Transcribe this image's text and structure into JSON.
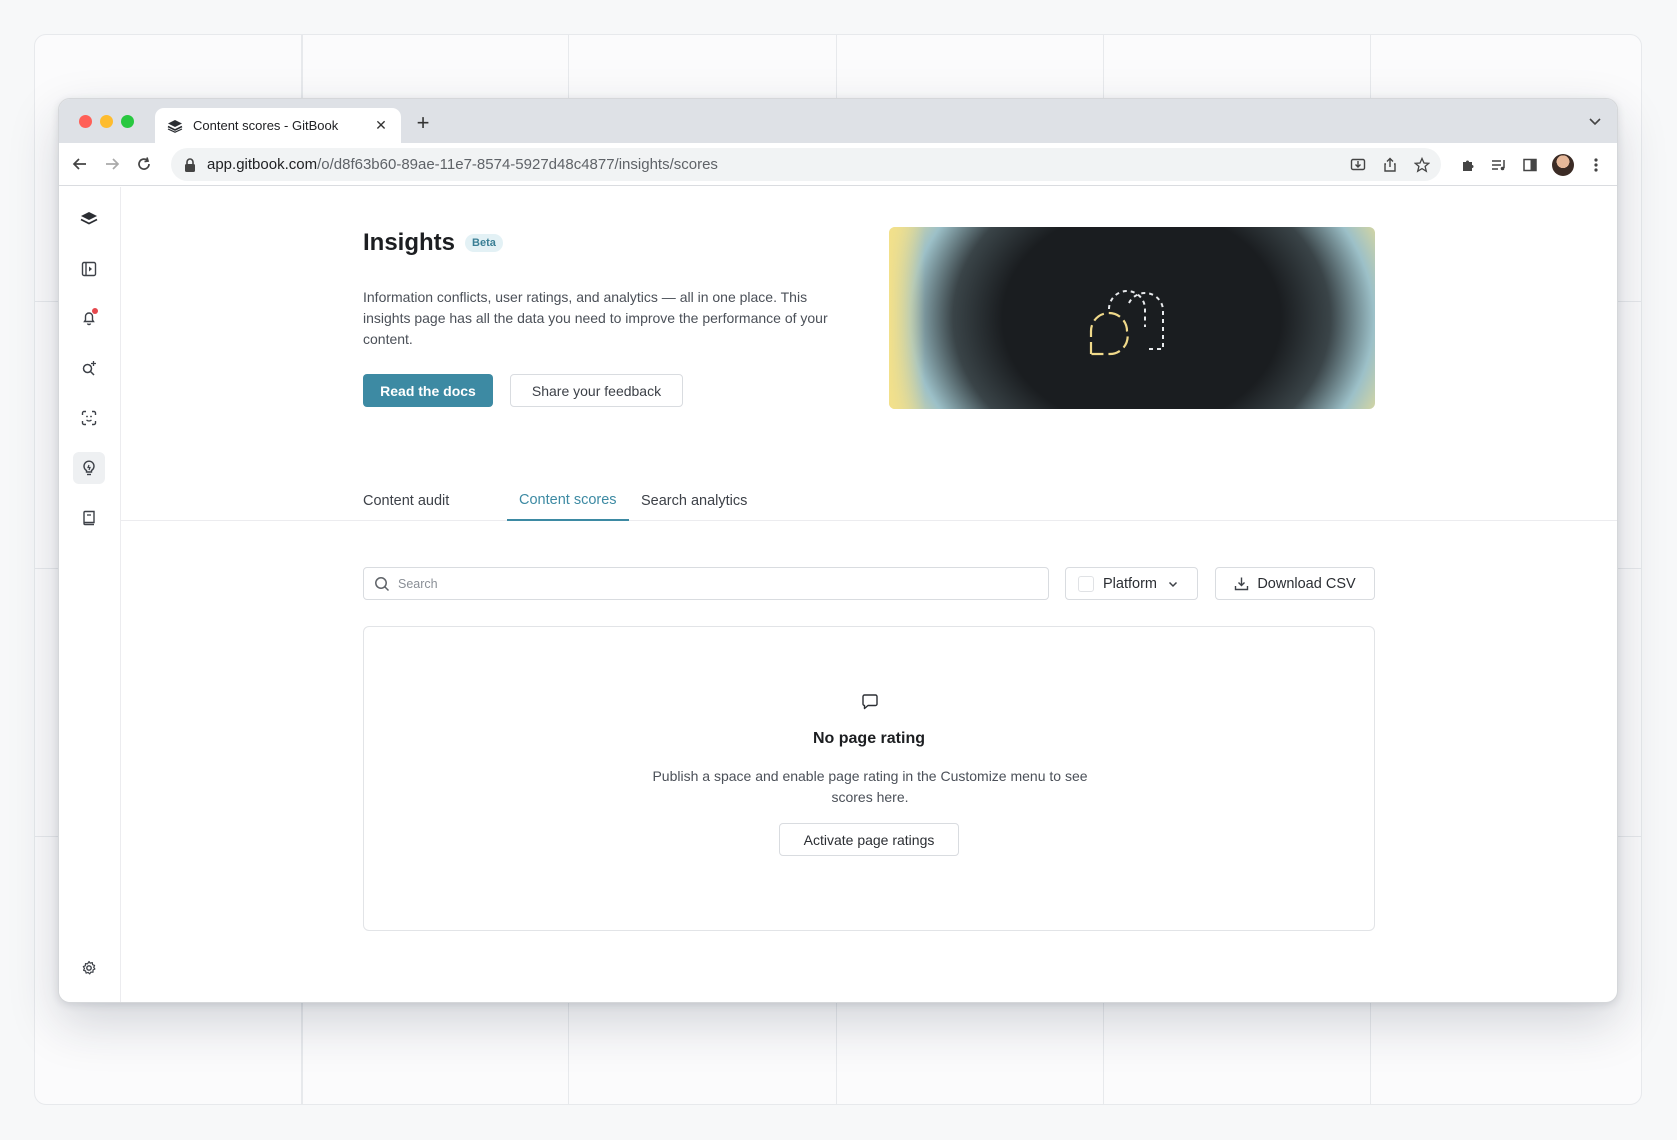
{
  "browser": {
    "tab_title": "Content scores - GitBook",
    "url_host": "app.gitbook.com",
    "url_path": "/o/d8f63b60-89ae-11e7-8574-5927d48c4877/insights/scores"
  },
  "sidebar": {
    "items": [
      {
        "icon": "gitbook-logo-icon"
      },
      {
        "icon": "panel-play-icon"
      },
      {
        "icon": "bell-icon",
        "has_notification": true
      },
      {
        "icon": "search-sparkle-icon"
      },
      {
        "icon": "scan-face-icon"
      },
      {
        "icon": "lightbulb-icon",
        "active": true
      },
      {
        "icon": "book-icon"
      },
      {
        "icon": "gear-icon"
      }
    ]
  },
  "hero": {
    "title": "Insights",
    "badge": "Beta",
    "description": "Information conflicts, user ratings, and analytics — all in one place. This insights page has all the data you need to improve the performance of your content.",
    "primary_button": "Read the docs",
    "secondary_button": "Share your feedback"
  },
  "tabs": {
    "items": [
      {
        "label": "Content audit"
      },
      {
        "label": "Content scores",
        "active": true
      },
      {
        "label": "Search analytics"
      }
    ]
  },
  "filters": {
    "search_placeholder": "Search",
    "search_value": "",
    "platform_label": "Platform",
    "download_label": "Download CSV"
  },
  "empty_state": {
    "title": "No page rating",
    "description": "Publish a space and enable page rating in the Customize menu to see scores here.",
    "button": "Activate page ratings"
  },
  "colors": {
    "accent": "#3d8aa3",
    "notification": "#e5484d"
  }
}
